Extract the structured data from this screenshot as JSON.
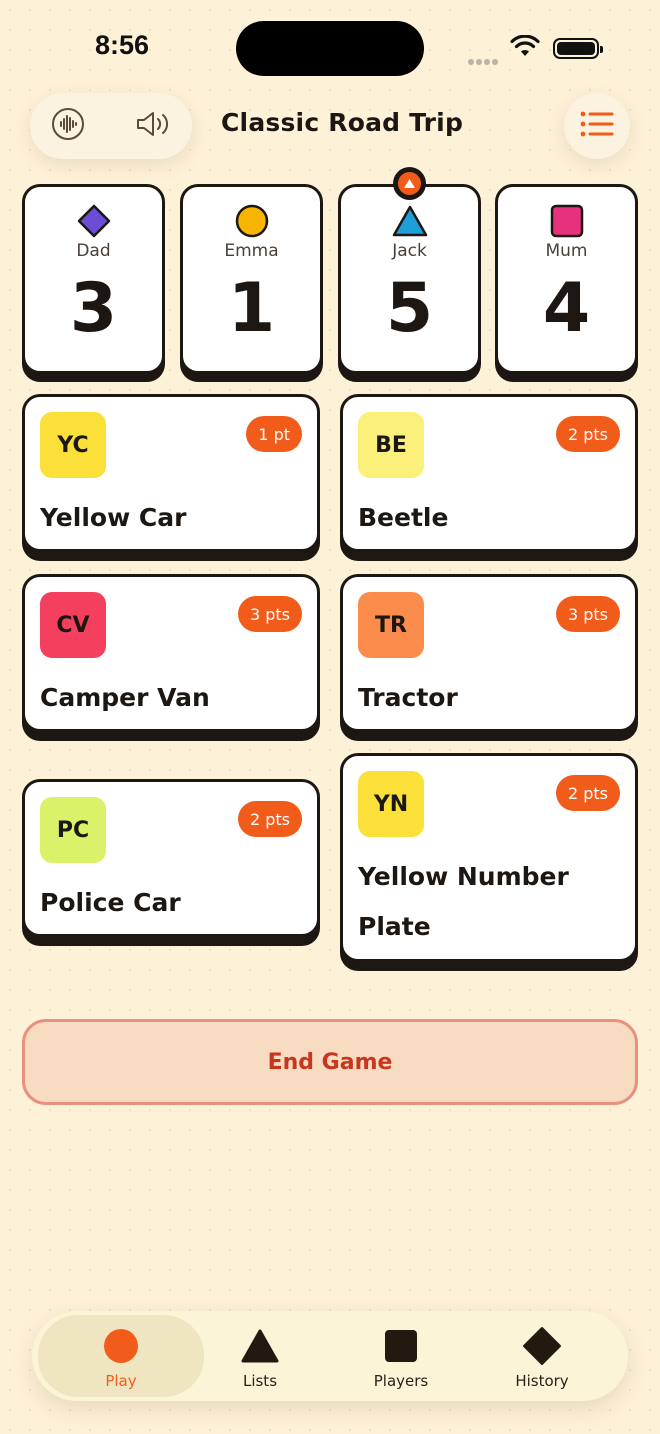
{
  "status": {
    "time": "8:56"
  },
  "header": {
    "title": "Classic Road Trip"
  },
  "players": [
    {
      "name": "Dad",
      "score": "3",
      "shape": "diamond",
      "color": "#6a4fd6"
    },
    {
      "name": "Emma",
      "score": "1",
      "shape": "circle",
      "color": "#f7b500"
    },
    {
      "name": "Jack",
      "score": "5",
      "shape": "triangle",
      "color": "#1f9fd8",
      "current_turn": true
    },
    {
      "name": "Mum",
      "score": "4",
      "shape": "square",
      "color": "#e8317c"
    }
  ],
  "items": [
    {
      "abbr": "YC",
      "name": "Yellow Car",
      "points": "1 pt",
      "color": "#fbe03a"
    },
    {
      "abbr": "BE",
      "name": "Beetle",
      "points": "2 pts",
      "color": "#fbf17a"
    },
    {
      "abbr": "CV",
      "name": "Camper Van",
      "points": "3 pts",
      "color": "#f43f5e"
    },
    {
      "abbr": "TR",
      "name": "Tractor",
      "points": "3 pts",
      "color": "#fb8c4c"
    },
    {
      "abbr": "PC",
      "name": "Police Car",
      "points": "2 pts",
      "color": "#d9f26a"
    },
    {
      "abbr": "YN",
      "name": "Yellow Number Plate",
      "points": "2 pts",
      "color": "#fbe03a"
    }
  ],
  "actions": {
    "end_game": "End Game"
  },
  "tabs": [
    {
      "label": "Play",
      "icon": "circle-icon",
      "active": true
    },
    {
      "label": "Lists",
      "icon": "triangle-icon"
    },
    {
      "label": "Players",
      "icon": "square-icon"
    },
    {
      "label": "History",
      "icon": "diamond-icon"
    }
  ],
  "colors": {
    "accent": "#f25c1a",
    "ink": "#1c1712",
    "background": "#fdf1d8",
    "danger": "#c8361f"
  }
}
